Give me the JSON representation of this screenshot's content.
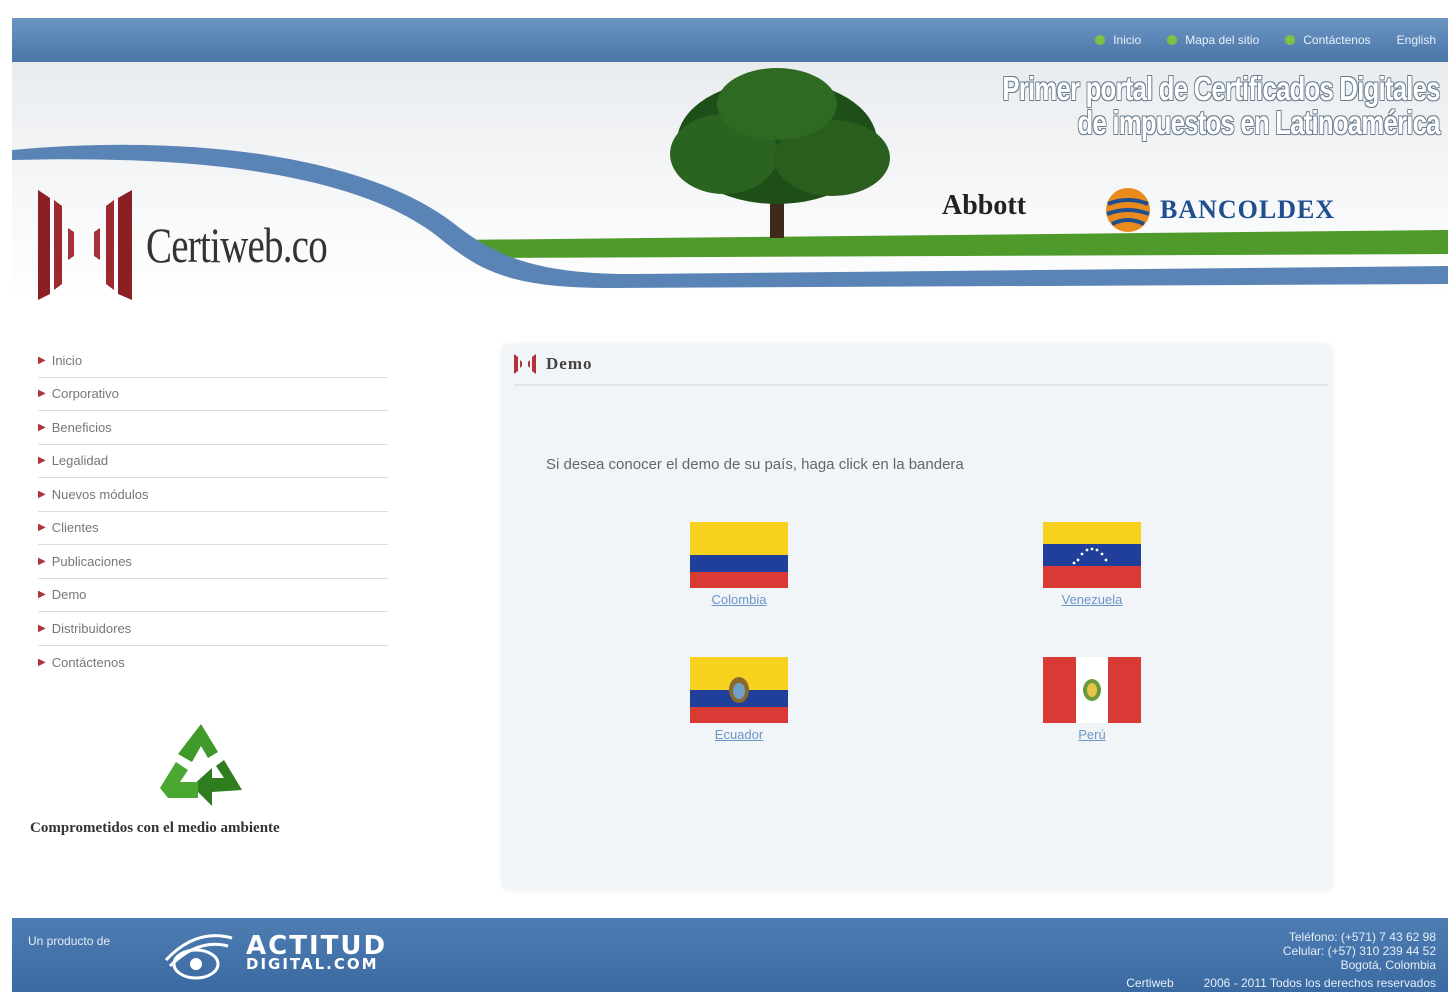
{
  "topnav": {
    "items": [
      "Inicio",
      "Mapa del sitio",
      "Contáctenos",
      "English"
    ]
  },
  "banner": {
    "slogan_line1": "Primer portal de Certificados Digitales",
    "slogan_line2": "de impuestos en Latinoamérica",
    "brand": "Certiweb.co",
    "client1": "Abbott",
    "client2": "BANCOLDEX"
  },
  "sidebar": {
    "items": [
      "Inicio",
      "Corporativo",
      "Beneficios",
      "Legalidad",
      "Nuevos módulos",
      "Clientes",
      "Publicaciones",
      "Demo",
      "Distribuidores",
      "Contáctenos"
    ],
    "commitment": "Comprometidos con el medio ambiente"
  },
  "main": {
    "title": "Demo",
    "instructions": "Si desea conocer el demo de su país, haga click en la bandera",
    "countries": [
      "Colombia",
      "Venezuela",
      "Ecuador",
      "Perú"
    ]
  },
  "footer": {
    "by_label": "Un producto de",
    "company_line1": "ACTITUD",
    "company_line2": "DIGITAL.COM",
    "phone": "Teléfono: (+571)    7 43 62 98",
    "mobile": "Celular: (+57) 310 239 44 52",
    "city": "Bogotá, Colombia",
    "brand": "Certiweb",
    "copyright": "2006 - 2011 Todos los derechos reservados"
  },
  "colors": {
    "nav_blue": "#4a76a8",
    "accent_red": "#b0323a",
    "grass_green": "#4e9a2a",
    "link_blue": "#6a96c8"
  }
}
